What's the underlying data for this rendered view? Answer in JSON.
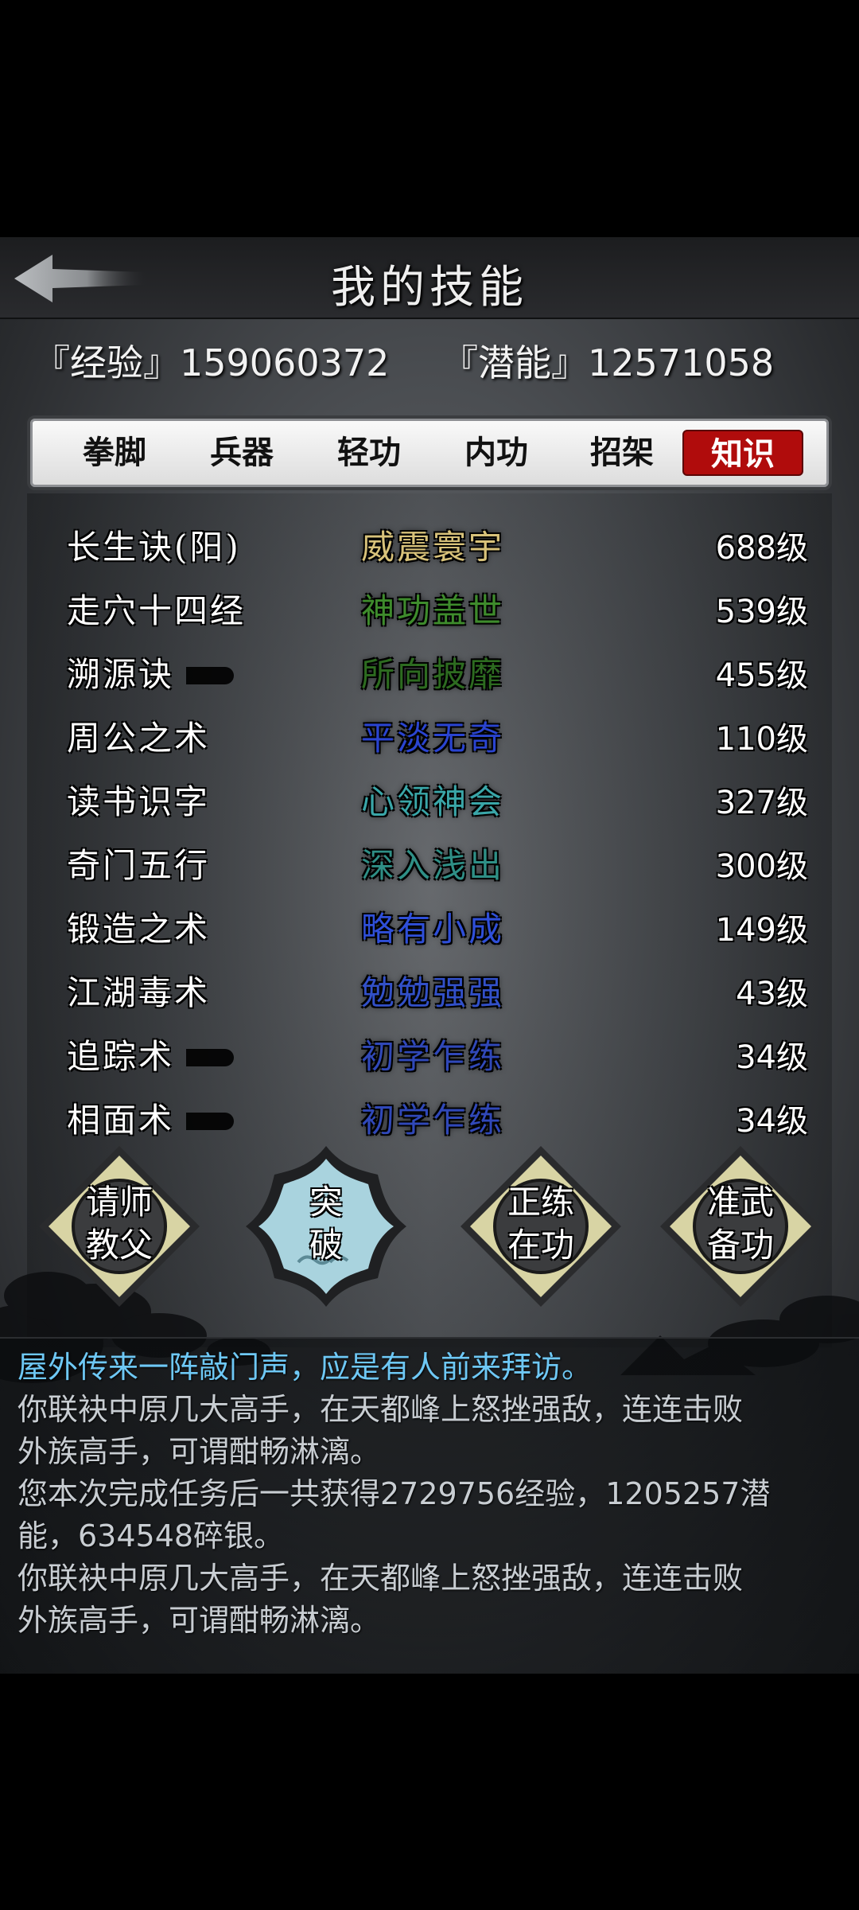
{
  "header": {
    "title": "我的技能"
  },
  "stats": {
    "exp": "『经验』159060372",
    "potential": "『潜能』12571058"
  },
  "tabs": [
    {
      "label": "拳脚",
      "active": false
    },
    {
      "label": "兵器",
      "active": false
    },
    {
      "label": "轻功",
      "active": false
    },
    {
      "label": "内功",
      "active": false
    },
    {
      "label": "招架",
      "active": false
    },
    {
      "label": "知识",
      "active": true
    }
  ],
  "skills": [
    {
      "name": "长生诀(阳)",
      "rank": "威震寰宇",
      "level": "688级",
      "rank_color": "#d8c27a"
    },
    {
      "name": "走穴十四经",
      "rank": "神功盖世",
      "level": "539级",
      "rank_color": "#3e8b2c"
    },
    {
      "name": "溯源诀",
      "rank": "所向披靡",
      "level": "455级",
      "rank_color": "#2d6b20"
    },
    {
      "name": "周公之术",
      "rank": "平淡无奇",
      "level": "110级",
      "rank_color": "#2a44d0"
    },
    {
      "name": "读书识字",
      "rank": "心领神会",
      "level": "327级",
      "rank_color": "#3aa6a8"
    },
    {
      "name": "奇门五行",
      "rank": "深入浅出",
      "level": "300级",
      "rank_color": "#2f8f86"
    },
    {
      "name": "锻造之术",
      "rank": "略有小成",
      "level": "149级",
      "rank_color": "#2f4fd8"
    },
    {
      "name": "江湖毒术",
      "rank": "勉勉强强",
      "level": "43级",
      "rank_color": "#3250c8"
    },
    {
      "name": "追踪术",
      "rank": "初学乍练",
      "level": "34级",
      "rank_color": "#3048b8"
    },
    {
      "name": "相面术",
      "rank": "初学乍练",
      "level": "34级",
      "rank_color": "#3048b8"
    }
  ],
  "actions": [
    {
      "line1": "请师",
      "line2": "教父"
    },
    {
      "line1": "突",
      "line2": "破"
    },
    {
      "line1": "正练",
      "line2": "在功"
    },
    {
      "line1": "准武",
      "line2": "备功"
    }
  ],
  "log": [
    {
      "text": "屋外传来一阵敲门声，应是有人前来拜访。",
      "highlight": true
    },
    {
      "text": "你联袂中原几大高手，在天都峰上怒挫强敌，连连击败",
      "highlight": false
    },
    {
      "text": "外族高手，可谓酣畅淋漓。",
      "highlight": false
    },
    {
      "text": "您本次完成任务后一共获得2729756经验，1205257潜",
      "highlight": false
    },
    {
      "text": "能，634548碎银。",
      "highlight": false
    },
    {
      "text": "你联袂中原几大高手，在天都峰上怒挫强敌，连连击败",
      "highlight": false
    },
    {
      "text": "外族高手，可谓酣畅淋漓。",
      "highlight": false
    }
  ]
}
